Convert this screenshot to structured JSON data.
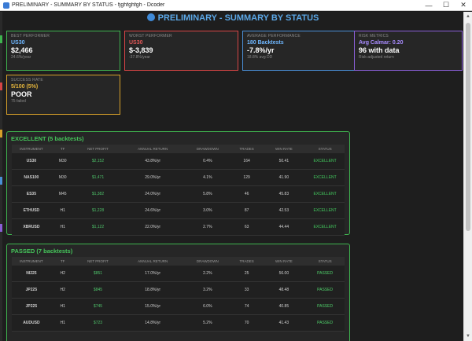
{
  "window": {
    "title": "PRELIMINARY - SUMMARY BY STATUS - fjghfghfgh - Dcoder",
    "minimize": "—",
    "maximize": "☐",
    "close": "✕"
  },
  "page": {
    "title": "PRELIMINARY - SUMMARY BY STATUS"
  },
  "cards": [
    {
      "label": "Best Performer",
      "line1": "US30",
      "line2": "$2,466",
      "line3": "24.6%/year",
      "color": "#3fb34f",
      "line1_color": "#6fb7ff"
    },
    {
      "label": "Worst Performer",
      "line1": "US30",
      "line2": "$-3,839",
      "line3": "-37.8%/year",
      "color": "#d64545",
      "line1_color": "#e05757"
    },
    {
      "label": "Average Performance",
      "line1": "180 Backtests",
      "line2": "-7.8%/yr",
      "line3": "18.8% avg DD",
      "color": "#4a8fd6",
      "line1_color": "#6fb7ff"
    },
    {
      "label": "Risk Metrics",
      "line1": "Avg Calmar: 0.20",
      "line2": "96 with data",
      "line3": "Risk-adjusted return",
      "color": "#8a5fd6",
      "line1_color": "#a98cff"
    },
    {
      "label": "Success Rate",
      "line1": "5/100 (5%)",
      "line2": "POOR",
      "line3": "75 failed",
      "color": "#d6a02a",
      "line1_color": "#e3b43c"
    }
  ],
  "columns": [
    "Instrument",
    "TF",
    "Net Profit",
    "Annual Return",
    "Drawdown",
    "Trades",
    "Win Rate",
    "Status"
  ],
  "excellent": {
    "title": "EXCELLENT (5 backtests)",
    "rows": [
      [
        "US30",
        "M30",
        "$2,152",
        "43.8%/yr",
        "0.4%",
        "164",
        "50.41",
        "EXCELLENT"
      ],
      [
        "NAS100",
        "M30",
        "$1,471",
        "29.0%/yr",
        "4.1%",
        "129",
        "41.90",
        "EXCELLENT"
      ],
      [
        "ES35",
        "M45",
        "$1,382",
        "24.0%/yr",
        "5.8%",
        "46",
        "45.83",
        "EXCELLENT"
      ],
      [
        "ETHUSD",
        "H1",
        "$1,228",
        "24.6%/yr",
        "3.0%",
        "87",
        "42.53",
        "EXCELLENT"
      ],
      [
        "XBRUSD",
        "H1",
        "$1,122",
        "22.0%/yr",
        "2.7%",
        "63",
        "44.44",
        "EXCELLENT"
      ]
    ]
  },
  "passed": {
    "title": "PASSED (7 backtests)",
    "rows": [
      [
        "NI225",
        "H2",
        "$851",
        "17.0%/yr",
        "2.2%",
        "25",
        "56.00",
        "PASSED"
      ],
      [
        "JP225",
        "H2",
        "$845",
        "18.8%/yr",
        "3.2%",
        "33",
        "48.48",
        "PASSED"
      ],
      [
        "JP225",
        "H1",
        "$745",
        "15.0%/yr",
        "6.0%",
        "74",
        "40.85",
        "PASSED"
      ],
      [
        "AUDUSD",
        "H1",
        "$723",
        "14.8%/yr",
        "5.2%",
        "70",
        "41.43",
        "PASSED"
      ]
    ]
  }
}
